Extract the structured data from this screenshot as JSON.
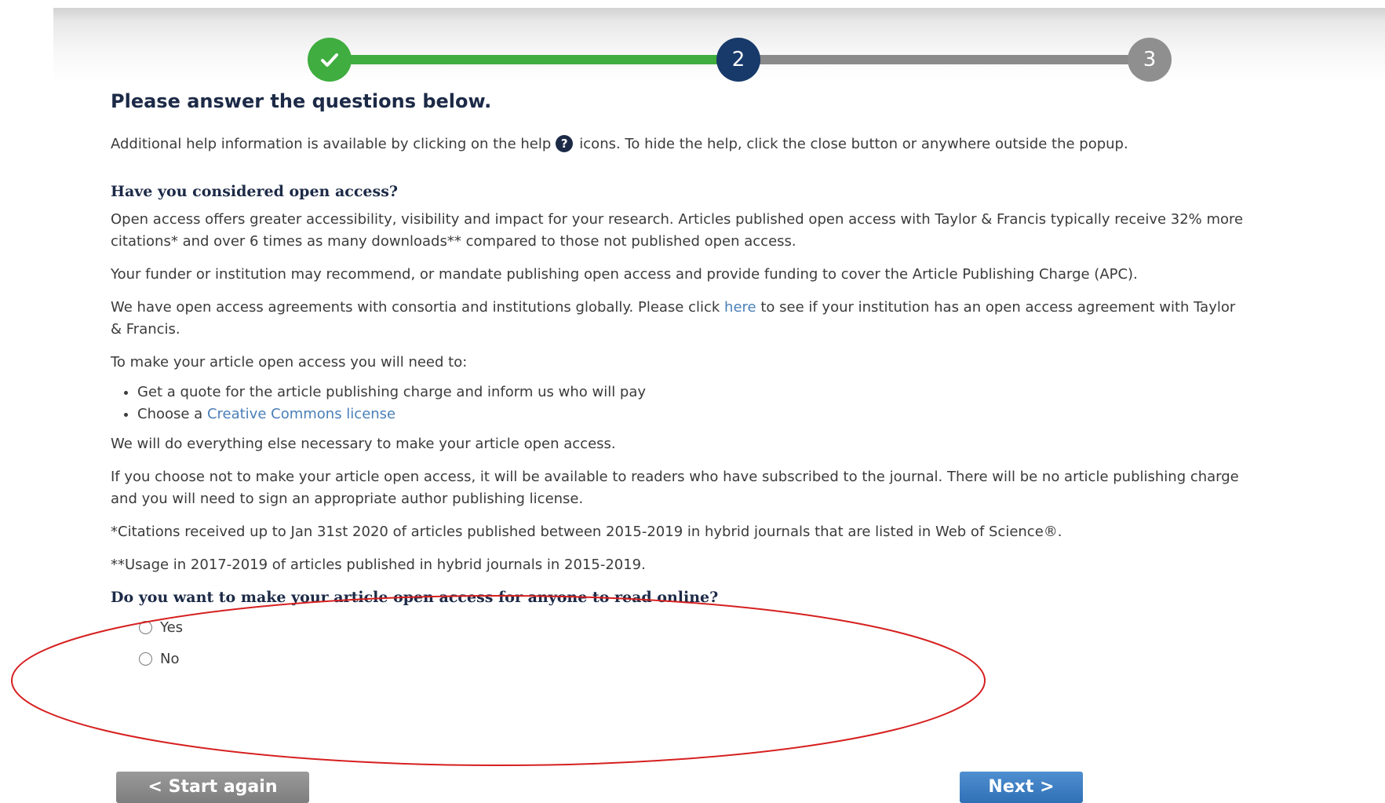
{
  "stepper": {
    "steps": [
      {
        "state": "completed",
        "label": ""
      },
      {
        "state": "current",
        "label": "2"
      },
      {
        "state": "upcoming",
        "label": "3"
      }
    ],
    "colors": {
      "completed": "#3fad3f",
      "current": "#173a6a",
      "upcoming": "#8f8f8f"
    }
  },
  "page": {
    "title": "Please answer the questions below.",
    "help_pre": "Additional help information is available by clicking on the help",
    "help_icon": "?",
    "help_post": "icons. To hide the help, click the close button or anywhere outside the popup."
  },
  "section": {
    "heading": "Have you considered open access?",
    "p1_line1": "Open access offers greater accessibility, visibility and impact for your research. Articles published open access with Taylor & Francis typically receive 32% more",
    "p1_line2": "citations* and over 6 times as many downloads** compared to those not published open access.",
    "p2": "Your funder or institution may recommend, or mandate publishing open access and provide funding to cover the Article Publishing Charge (APC).",
    "p3_line1_pre": "We have open access agreements with consortia and institutions globally. Please click ",
    "p3_link": "here",
    "p3_line1_post": " to see if your institution has an open access agreement with Taylor",
    "p3_line2": "& Francis.",
    "p4": "To make your article open access you will need to:",
    "bullet1": "Get a quote for the article publishing charge and inform us who will pay",
    "bullet2_pre": "Choose a ",
    "bullet2_link": "Creative Commons license",
    "p5": "We will do everything else necessary to make your article open access.",
    "p6_line1": "If you choose not to make your article open access, it will be available to readers who have subscribed to the journal. There will be no article publishing charge",
    "p6_line2": "and you will need to sign an appropriate author publishing license.",
    "footnote1": "*Citations received up to Jan 31st 2020 of articles published between 2015-2019 in hybrid journals that are listed in Web of Science®.",
    "footnote2": "**Usage in 2017-2019 of articles published in hybrid journals in 2015-2019."
  },
  "question": {
    "text": "Do you want to make your article open access for anyone to read online?",
    "options": [
      "Yes",
      "No"
    ],
    "selected": null
  },
  "buttons": {
    "start_again": "< Start again",
    "next": "Next >"
  },
  "annotation": {
    "shape": "ellipse",
    "color": "#d61f1f"
  }
}
